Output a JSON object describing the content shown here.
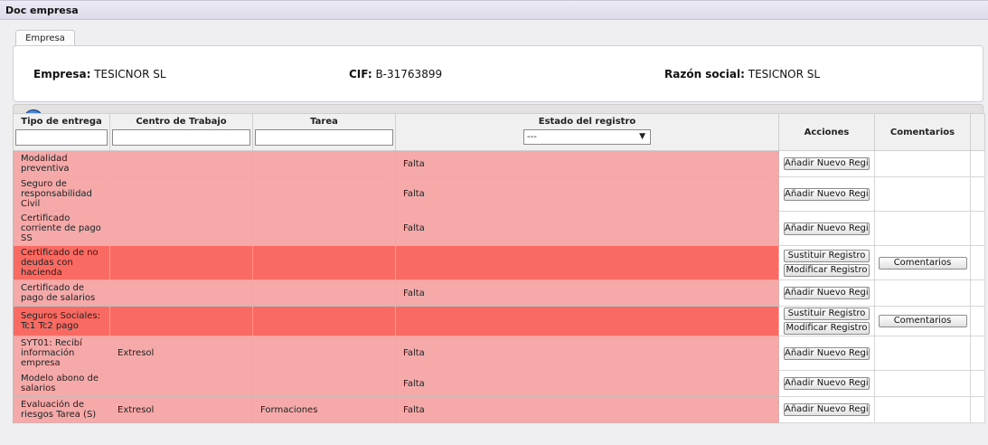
{
  "window": {
    "title": "Doc empresa"
  },
  "tabs": [
    {
      "label": "Empresa"
    }
  ],
  "company": {
    "empresa_label": "Empresa:",
    "empresa_value": "TESICNOR SL",
    "cif_label": "CIF:",
    "cif_value": "B-31763899",
    "razon_label": "Razón social:",
    "razon_value": "TESICNOR SL"
  },
  "colors": {
    "falta_row": "#f5a9a9",
    "error_row": "#f86a62",
    "header_bg": "#f0f0f0"
  },
  "icons": {
    "back": "back-arrow-icon",
    "dropdown": "chevron-down-icon"
  },
  "table": {
    "headers": {
      "tipo": "Tipo de entrega",
      "centro": "Centro de Trabajo",
      "tarea": "Tarea",
      "estado": "Estado del registro",
      "acciones": "Acciones",
      "comentarios": "Comentarios"
    },
    "estado_filter": {
      "selected": "---"
    },
    "rows": [
      {
        "tipo": "Modalidad preventiva",
        "centro": "",
        "tarea": "",
        "estado": "Falta",
        "actions": [
          "Añadir Nuevo Registro"
        ],
        "comment": ""
      },
      {
        "tipo": "Seguro de responsabilidad Civil",
        "centro": "",
        "tarea": "",
        "estado": "Falta",
        "actions": [
          "Añadir Nuevo Registro"
        ],
        "comment": ""
      },
      {
        "tipo": "Certificado corriente de pago SS",
        "centro": "",
        "tarea": "",
        "estado": "Falta",
        "actions": [
          "Añadir Nuevo Registro"
        ],
        "comment": ""
      },
      {
        "tipo": "Certificado de no deudas con hacienda",
        "centro": "",
        "tarea": "",
        "estado": "",
        "actions": [
          "Sustituir Registro",
          "Modificar Registro"
        ],
        "comment": "Comentarios"
      },
      {
        "tipo": "Certificado de pago de salarios",
        "centro": "",
        "tarea": "",
        "estado": "Falta",
        "actions": [
          "Añadir Nuevo Registro"
        ],
        "comment": ""
      },
      {
        "tipo": "Seguros Sociales: Tc1 Tc2 pago",
        "centro": "",
        "tarea": "",
        "estado": "",
        "actions": [
          "Sustituir Registro",
          "Modificar Registro"
        ],
        "comment": "Comentarios"
      },
      {
        "tipo": "SYT01: Recibí información empresa",
        "centro": "Extresol",
        "tarea": "",
        "estado": "Falta",
        "actions": [
          "Añadir Nuevo Registro"
        ],
        "comment": ""
      },
      {
        "tipo": "Modelo abono de salarios",
        "centro": "",
        "tarea": "",
        "estado": "Falta",
        "actions": [
          "Añadir Nuevo Registro"
        ],
        "comment": ""
      },
      {
        "tipo": "Evaluación de riesgos Tarea (S)",
        "centro": "Extresol",
        "tarea": "Formaciones",
        "estado": "Falta",
        "actions": [
          "Añadir Nuevo Registro"
        ],
        "comment": ""
      }
    ]
  }
}
